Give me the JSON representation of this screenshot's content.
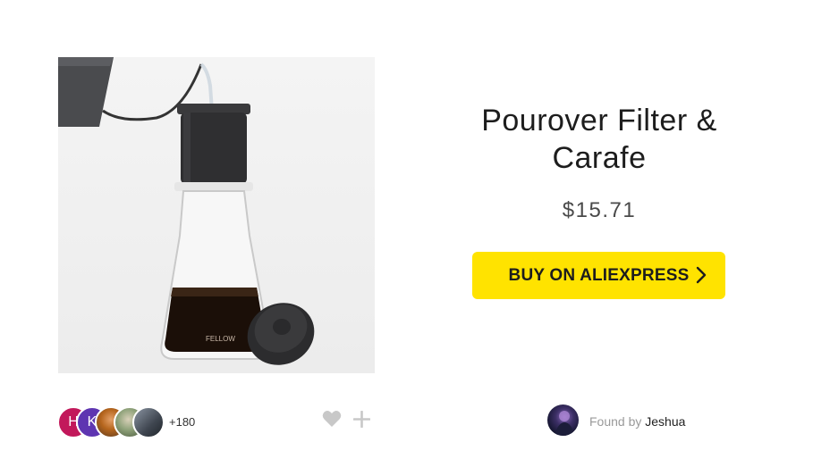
{
  "product": {
    "title": "Pourover Filter & Carafe",
    "price": "$15.71",
    "image_alt_icon": "pourover-carafe-photo",
    "carafe_brand": "FELLOW"
  },
  "buy": {
    "label": "BUY ON ALIEXPRESS",
    "color": "#ffe300"
  },
  "fans": {
    "avatars": [
      {
        "initial": "H",
        "color": "#c2185b"
      },
      {
        "initial": "K",
        "color": "#5e35b1"
      },
      {
        "initial": "",
        "color": "#b5651d"
      },
      {
        "initial": "",
        "color": "#6d8a5a"
      },
      {
        "initial": "",
        "color": "#3f4650"
      }
    ],
    "count": "+180"
  },
  "actions": {
    "heart_icon": "heart-icon",
    "plus_icon": "plus-icon"
  },
  "finder": {
    "prefix": "Found by",
    "name": "Jeshua"
  }
}
